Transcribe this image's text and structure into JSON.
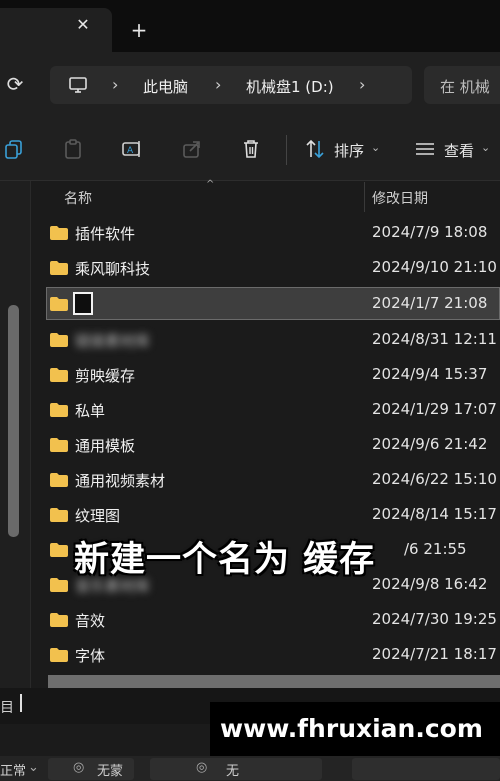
{
  "tab": {
    "close_glyph": "✕",
    "new_glyph": "+"
  },
  "address": {
    "crumbs": [
      "此电脑",
      "机械盘1 (D:)"
    ],
    "separator": "›",
    "search_placeholder": "在 机械"
  },
  "toolbar": {
    "sort_label": "排序",
    "view_label": "查看",
    "chevron": "⌄"
  },
  "list": {
    "columns": {
      "name": "名称",
      "date": "修改日期"
    },
    "sort_arrow": "^",
    "rows": [
      {
        "name": "插件软件",
        "date": "2024/7/9 18:08",
        "blurred": false,
        "selected": false
      },
      {
        "name": "乘风聊科技",
        "date": "2024/9/10 21:10",
        "blurred": false,
        "selected": false
      },
      {
        "name": "",
        "date": "2024/1/7 21:08",
        "blurred": false,
        "selected": true
      },
      {
        "name": "链接素材库",
        "date": "2024/8/31 12:11",
        "blurred": true,
        "selected": false
      },
      {
        "name": "剪映缓存",
        "date": "2024/9/4 15:37",
        "blurred": false,
        "selected": false
      },
      {
        "name": "私单",
        "date": "2024/1/29 17:07",
        "blurred": false,
        "selected": false
      },
      {
        "name": "通用模板",
        "date": "2024/9/6 21:42",
        "blurred": false,
        "selected": false
      },
      {
        "name": "通用视频素材",
        "date": "2024/6/22 15:10",
        "blurred": false,
        "selected": false
      },
      {
        "name": "纹理图",
        "date": "2024/8/14 15:17",
        "blurred": false,
        "selected": false
      },
      {
        "name": "",
        "date": "/6 21:55",
        "blurred": false,
        "selected": false
      },
      {
        "name": "音乐素材库",
        "date": "2024/9/8 16:42",
        "blurred": true,
        "selected": false
      },
      {
        "name": "音效",
        "date": "2024/7/30 19:25",
        "blurred": false,
        "selected": false
      },
      {
        "name": "字体",
        "date": "2024/7/21 18:17",
        "blurred": false,
        "selected": false
      }
    ]
  },
  "caption": "新建一个名为 缓存",
  "status": {
    "text": "目"
  },
  "watermark": "www.fhruxian.com",
  "bottom_panel": {
    "left_value": "正常",
    "mid_value": "无蒙",
    "right_value": "无"
  },
  "colors": {
    "folder": "#f2c14e",
    "selection": "#3e3e3e"
  }
}
